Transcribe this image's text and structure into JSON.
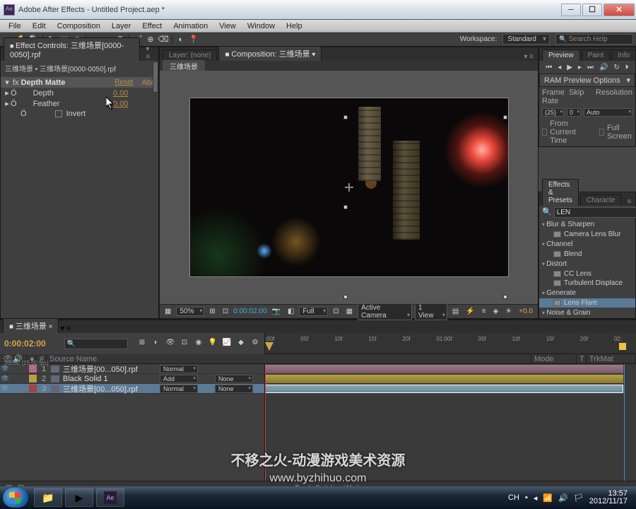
{
  "title": "Adobe After Effects - Untitled Project.aep *",
  "menu": [
    "File",
    "Edit",
    "Composition",
    "Layer",
    "Effect",
    "Animation",
    "View",
    "Window",
    "Help"
  ],
  "workspace_label": "Workspace:",
  "workspace_value": "Standard",
  "search_placeholder": "Search Help",
  "effect_controls": {
    "tab": "Effect Controls: 三维场景[0000-0050].rpf",
    "path": "三维场景 • 三维场景[0000-0050].rpf",
    "fx_name": "Depth Matte",
    "reset": "Reset",
    "about": "Abo",
    "props": [
      {
        "name": "Depth",
        "value": "0.00"
      },
      {
        "name": "Feather",
        "value": "0.00"
      }
    ],
    "invert": "Invert"
  },
  "comp": {
    "layer_tab": "Layer: (none)",
    "comp_tab": "Composition: 三维场景",
    "subtab": "三维场景",
    "footer": {
      "zoom": "50%",
      "time": "0:00:02:00",
      "res": "Full",
      "camera": "Active Camera",
      "view": "1 View",
      "exposure": "+0.0"
    }
  },
  "preview": {
    "tabs": [
      "Preview",
      "Paint",
      "Info"
    ],
    "ram_options": "RAM Preview Options",
    "labels": {
      "fr": "Frame Rate",
      "skip": "Skip",
      "res": "Resolution"
    },
    "fr": "(25)",
    "skip": "0",
    "res": "Auto",
    "from_current": "From Current Time",
    "full_screen": "Full Screen"
  },
  "effects_presets": {
    "tabs": [
      "Effects & Presets",
      "Characte"
    ],
    "search": "LEN",
    "cats": [
      {
        "name": "Blur & Sharpen",
        "items": [
          "Camera Lens Blur"
        ]
      },
      {
        "name": "Channel",
        "items": [
          "Blend"
        ]
      },
      {
        "name": "Distort",
        "items": [
          "CC Lens",
          "Turbulent Displace"
        ]
      },
      {
        "name": "Generate",
        "items": [
          "Lens Flare"
        ],
        "sel": 0
      },
      {
        "name": "Noise & Grain",
        "items": []
      }
    ]
  },
  "timeline": {
    "tab": "三维场景",
    "time": "0:00:02:00",
    "sub": "00050 (25.00 fps)",
    "cols": {
      "source": "Source Name",
      "mode": "Mode",
      "trk": "TrkMat"
    },
    "ticks": [
      ":00f",
      "05f",
      "10f",
      "15f",
      "20f",
      "01:00f",
      "05f",
      "10f",
      "15f",
      "20f",
      "02:"
    ],
    "layers": [
      {
        "n": "1",
        "name": "三维场景[00...050].rpf",
        "mode": "Normal",
        "trk": "",
        "color": "c-pink"
      },
      {
        "n": "2",
        "name": "Black Solid 1",
        "mode": "Add",
        "trk": "None",
        "color": "c-yel"
      },
      {
        "n": "3",
        "name": "三维场景[00...050].rpf",
        "mode": "Normal",
        "trk": "None",
        "color": "c-red",
        "sel": true
      }
    ],
    "toggle": "Toggle Switches / Modes"
  },
  "watermark": {
    "l1": "不移之火-动漫游戏美术资源",
    "l2": "www.byzhihuo.com"
  },
  "tray": {
    "ime": "CH",
    "time": "13:57",
    "date": "2012/11/17"
  }
}
